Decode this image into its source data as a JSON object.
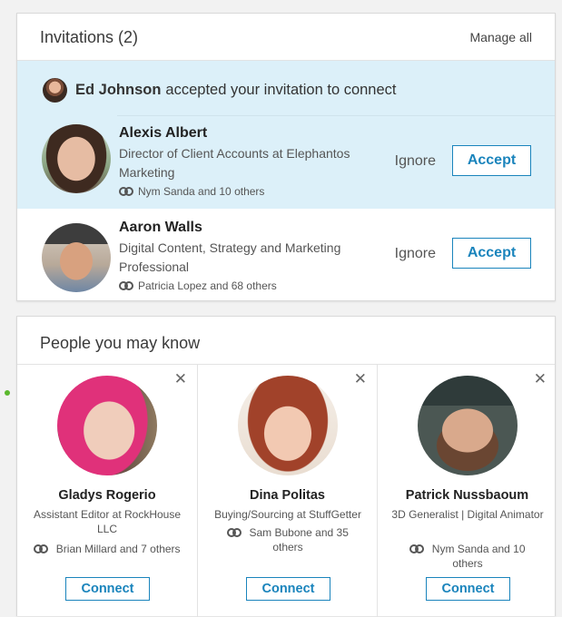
{
  "invitations": {
    "title": "Invitations (2)",
    "manage_all": "Manage all",
    "accepted": {
      "name": "Ed Johnson",
      "text": "accepted your invitation to connect"
    },
    "items": [
      {
        "name": "Alexis Albert",
        "headline": "Director of Client Accounts at Elephantos Marketing",
        "shared": "Nym Sanda and 10 others",
        "ignore_label": "Ignore",
        "accept_label": "Accept"
      },
      {
        "name": "Aaron Walls",
        "headline": "Digital Content, Strategy and Marketing Professional",
        "shared": "Patricia Lopez and 68 others",
        "ignore_label": "Ignore",
        "accept_label": "Accept"
      }
    ]
  },
  "pymk": {
    "title": "People you may know",
    "dismiss_glyph": "✕",
    "people": [
      {
        "name": "Gladys Rogerio",
        "headline": "Assistant Editor at RockHouse LLC",
        "shared": "Brian Millard and 7 others",
        "connect_label": "Connect"
      },
      {
        "name": "Dina Politas",
        "headline": "Buying/Sourcing at StuffGetter",
        "shared": "Sam Bubone and 35 others",
        "connect_label": "Connect"
      },
      {
        "name": "Patrick Nussbaoum",
        "headline": "3D Generalist | Digital Animator",
        "shared": "Nym Sanda and 10 others",
        "connect_label": "Connect"
      }
    ]
  },
  "colors": {
    "accent": "#1a84bc",
    "accepted_band": "#dcf0f9",
    "background": "#f2f2f2"
  }
}
